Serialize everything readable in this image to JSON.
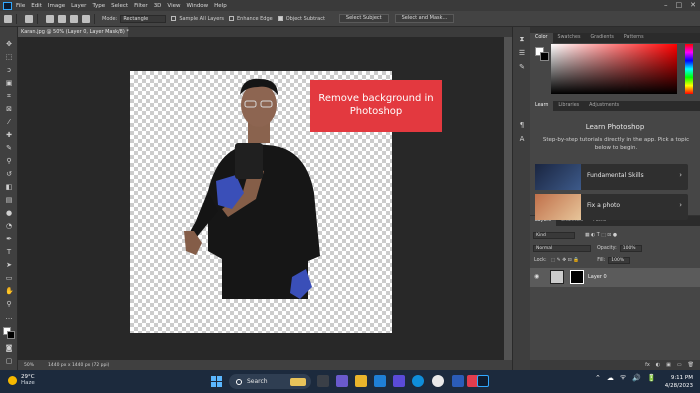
{
  "menu": [
    "File",
    "Edit",
    "Image",
    "Layer",
    "Type",
    "Select",
    "Filter",
    "3D",
    "View",
    "Window",
    "Help"
  ],
  "window_controls": [
    "–",
    "□",
    "✕"
  ],
  "options": {
    "mode_label": "Mode:",
    "mode_value": "Rectangle",
    "sample_all_layers": "Sample All Layers",
    "enhance_edge": "Enhance Edge",
    "object_subtract": "Object Subtract",
    "select_subject": "Select Subject",
    "select_and_mask": "Select and Mask..."
  },
  "document": {
    "tab_title": "Karan.jpg @ 50% (Layer 0, Layer Mask/8) *",
    "zoom": "50%",
    "size": "1440 px x 1440 px (72 ppi)"
  },
  "overlay_banner": "Remove background in Photoshop",
  "panels": {
    "color_tabs": [
      "Color",
      "Swatches",
      "Gradients",
      "Patterns"
    ],
    "learn_tabs": [
      "Learn",
      "Libraries",
      "Adjustments"
    ],
    "learn_title": "Learn Photoshop",
    "learn_desc": "Step-by-step tutorials directly in the app. Pick a topic below to begin.",
    "learn_cards": [
      "Fundamental Skills",
      "Fix a photo"
    ],
    "layer_tabs": [
      "Layers",
      "Channels",
      "Paths"
    ],
    "kind_label": "Kind",
    "blend_mode": "Normal",
    "opacity_label": "Opacity:",
    "opacity_value": "100%",
    "lock_label": "Lock:",
    "fill_label": "Fill:",
    "fill_value": "100%",
    "layer_name": "Layer 0",
    "bottom_icons": [
      "fx",
      "◐",
      "▣",
      "▭",
      "🗑"
    ]
  },
  "taskbar": {
    "temperature": "29°C",
    "condition": "Haze",
    "search_label": "Search",
    "time": "9:11 PM",
    "date": "4/28/2023",
    "tray_icons": [
      "⌃",
      "☁",
      "ᯤ",
      "🔊",
      "🔋"
    ]
  },
  "colors": {
    "banner": "#e3393f",
    "ps_accent": "#31a8ff",
    "taskbar": "#1c2a3d"
  }
}
